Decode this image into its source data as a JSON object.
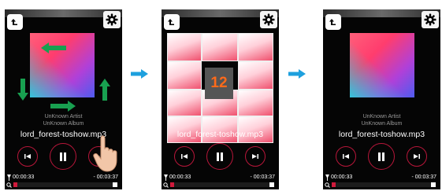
{
  "screens": [
    {
      "song": {
        "artist": "UnKnown Artist",
        "album": "UnKnown Album",
        "file": "lord_forest-toshow.mp3"
      },
      "time": {
        "elapsed": "00:00:33",
        "remaining": "- 00:03:37"
      },
      "progress": 0.04
    },
    {
      "song": {
        "file": "lord_forest-toshow.mp3"
      },
      "time": {
        "elapsed": "00:00:33",
        "remaining": "- 00:03:37"
      },
      "counter": "12",
      "progress": 0.04
    },
    {
      "song": {
        "artist": "UnKnown Artist",
        "album": "UnKnown Album",
        "file": "lord_forest-toshow.mp3"
      },
      "time": {
        "elapsed": "00:00:33",
        "remaining": "- 00:03:37"
      },
      "progress": 0.04
    }
  ],
  "icons": {
    "back": "back-icon",
    "settings": "gear-icon",
    "previous": "previous-icon",
    "pause": "pause-icon",
    "next": "next-icon",
    "swipe_arrows": "arrow-icon",
    "step_arrow": "right-arrow-icon",
    "hand": "hand-pointer-icon"
  },
  "colors": {
    "accent": "#d01a3c",
    "swipe_arrow": "#18a050",
    "step_arrow": "#1ea0de",
    "counter_text": "#ff6a1a"
  }
}
